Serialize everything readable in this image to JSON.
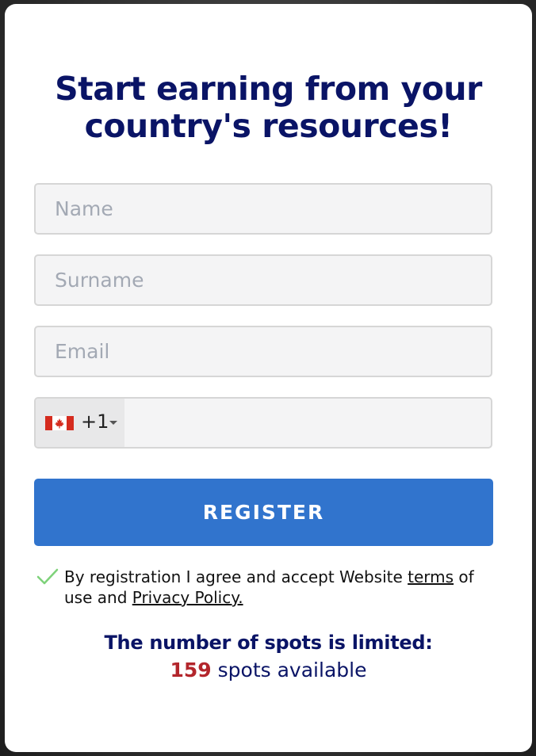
{
  "form": {
    "title": "Start earning from your country's resources!",
    "name_placeholder": "Name",
    "surname_placeholder": "Surname",
    "email_placeholder": "Email",
    "phone": {
      "country_flag": "canada-flag-icon",
      "dial_code": "+1",
      "value": ""
    },
    "register_label": "REGISTER",
    "agreement": {
      "prefix": "By registration I agree and accept Website ",
      "terms_link": "terms",
      "middle": " of use and ",
      "privacy_link": "Privacy Policy."
    },
    "limited_text": "The number of spots is limited:",
    "spots_count": "159",
    "spots_suffix": " spots available"
  },
  "colors": {
    "title": "#0a1466",
    "button": "#3174cd",
    "count": "#b3262c",
    "check": "#7ed27a"
  }
}
